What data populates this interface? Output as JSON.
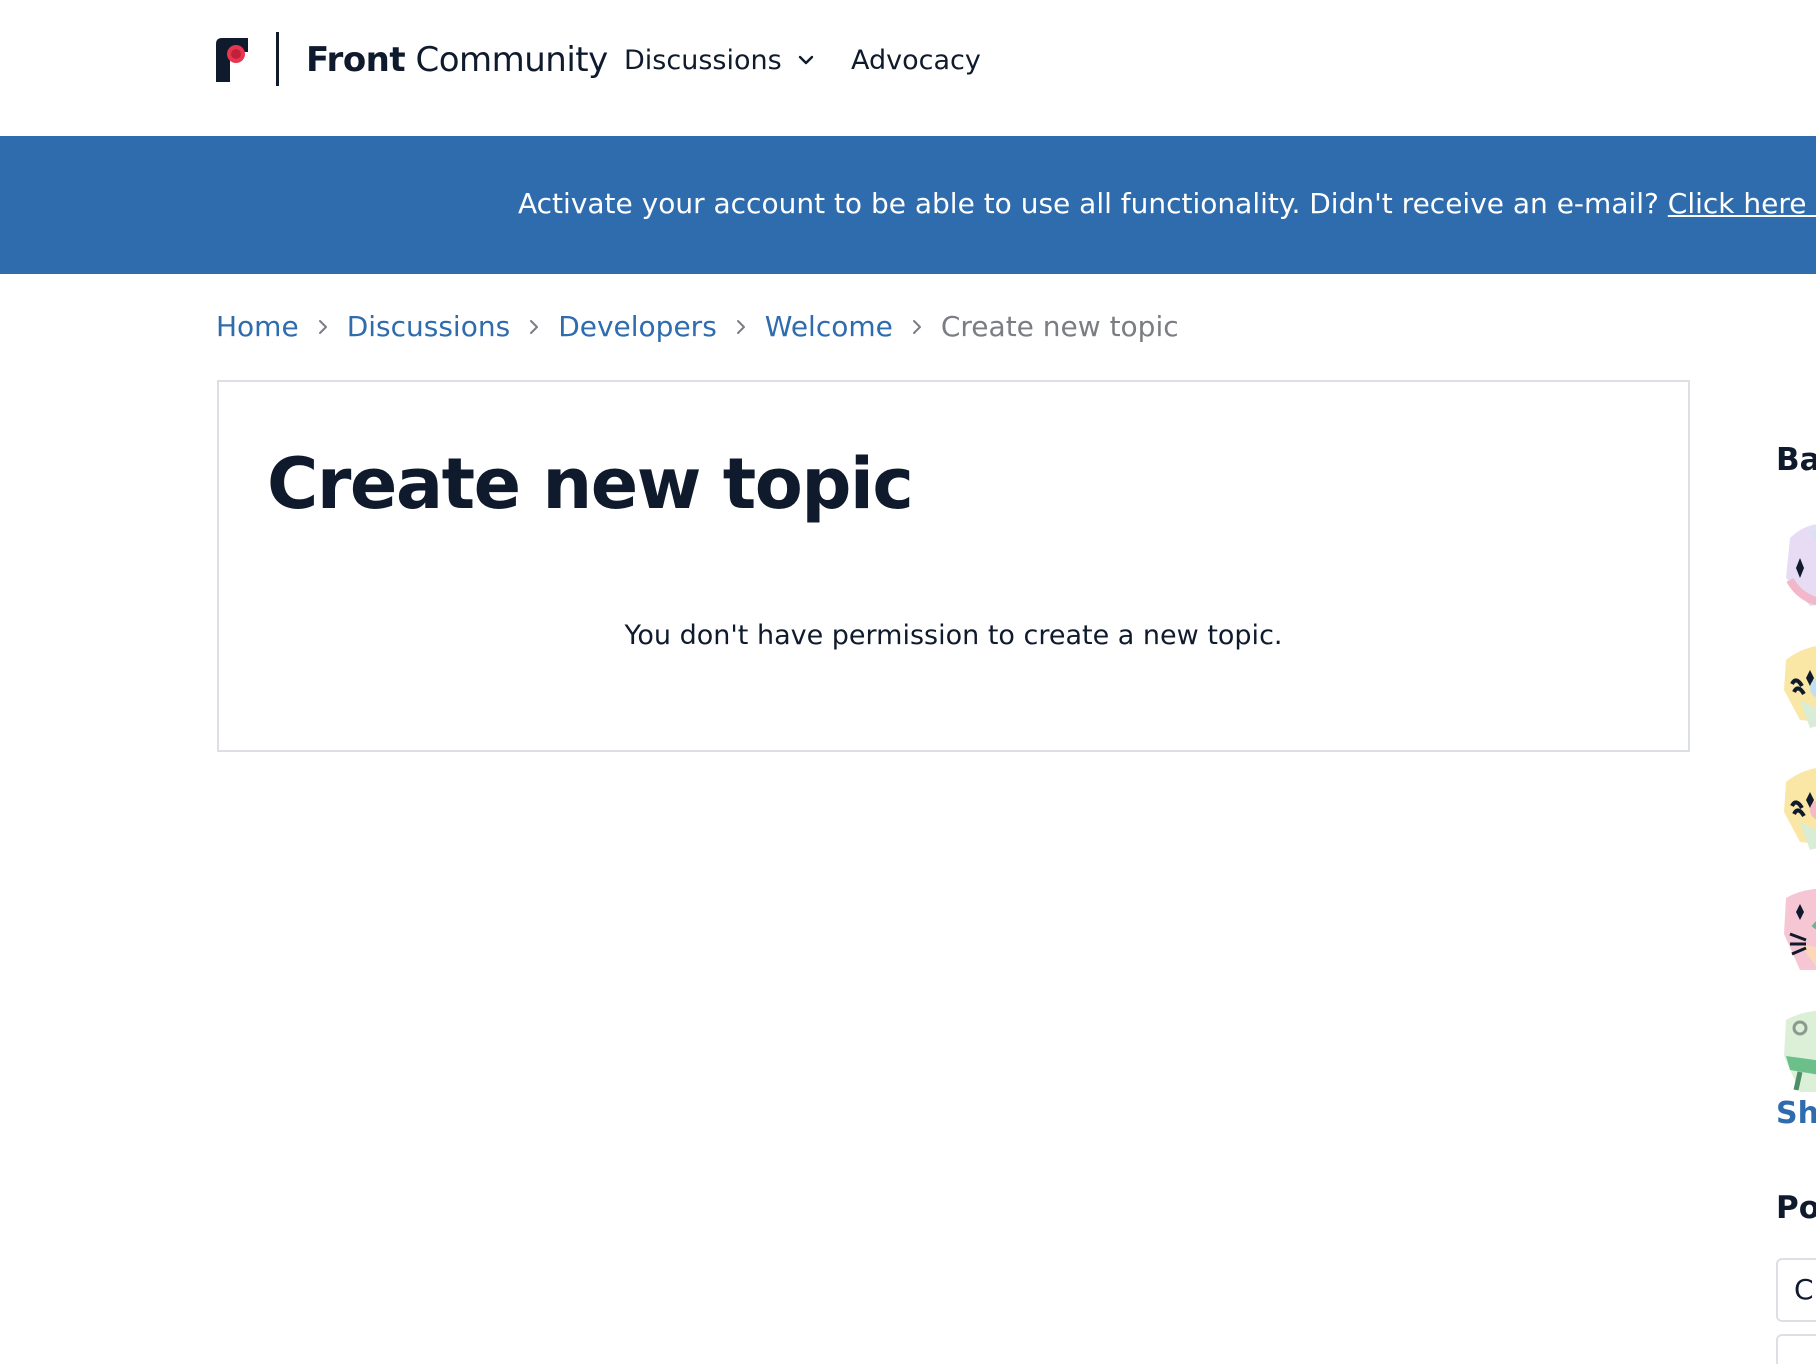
{
  "header": {
    "logo_bold": "Front",
    "logo_light": "Community",
    "nav": [
      {
        "label": "Discussions",
        "has_dropdown": true
      },
      {
        "label": "Advocacy",
        "has_dropdown": false
      }
    ]
  },
  "banner": {
    "text": "Activate your account to be able to use all functionality. Didn't receive an e-mail? ",
    "link_text": "Click here to request",
    "color": "#2f6cae"
  },
  "breadcrumb": {
    "items": [
      "Home",
      "Discussions",
      "Developers",
      "Welcome"
    ],
    "current": "Create new topic"
  },
  "main": {
    "title": "Create new topic",
    "message": "You don't have permission to create a new topic."
  },
  "sidebar": {
    "badges_heading": "Ba",
    "badge_icons": [
      "badge-icon",
      "badge-icon",
      "badge-icon",
      "badge-icon",
      "badge-icon"
    ],
    "show_all_label": "Sho",
    "popular_heading": "Po",
    "popular_tab_label": "C"
  },
  "colors": {
    "accent": "#2f6cae",
    "text_primary": "#0f1b2d",
    "text_muted": "#7a7d82",
    "border": "#dcdfe3",
    "logo_red": "#e8364f"
  }
}
